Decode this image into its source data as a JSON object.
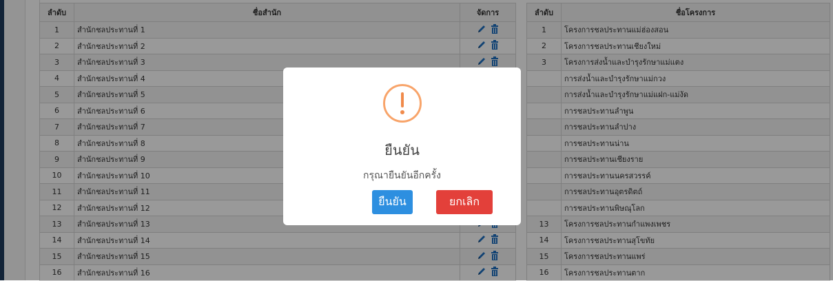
{
  "left_table": {
    "headers": {
      "no": "ลำดับ",
      "name": "ชื่อสำนัก",
      "manage": "จัดการ"
    },
    "rows": [
      {
        "no": "1",
        "name": "สำนักชลประทานที่ 1"
      },
      {
        "no": "2",
        "name": "สำนักชลประทานที่ 2"
      },
      {
        "no": "3",
        "name": "สำนักชลประทานที่ 3"
      },
      {
        "no": "4",
        "name": "สำนักชลประทานที่ 4"
      },
      {
        "no": "5",
        "name": "สำนักชลประทานที่ 5"
      },
      {
        "no": "6",
        "name": "สำนักชลประทานที่ 6"
      },
      {
        "no": "7",
        "name": "สำนักชลประทานที่ 7"
      },
      {
        "no": "8",
        "name": "สำนักชลประทานที่ 8"
      },
      {
        "no": "9",
        "name": "สำนักชลประทานที่ 9"
      },
      {
        "no": "10",
        "name": "สำนักชลประทานที่ 10"
      },
      {
        "no": "11",
        "name": "สำนักชลประทานที่ 11"
      },
      {
        "no": "12",
        "name": "สำนักชลประทานที่ 12"
      },
      {
        "no": "13",
        "name": "สำนักชลประทานที่ 13"
      },
      {
        "no": "14",
        "name": "สำนักชลประทานที่ 14"
      },
      {
        "no": "15",
        "name": "สำนักชลประทานที่ 15"
      },
      {
        "no": "16",
        "name": "สำนักชลประทานที่ 16"
      }
    ]
  },
  "right_table": {
    "headers": {
      "no": "ลำดับ",
      "name": "ชื่อโครงการ"
    },
    "rows": [
      {
        "no": "1",
        "name": "โครงการชลประทานแม่ฮ่องสอน"
      },
      {
        "no": "2",
        "name": "โครงการชลประทานเชียงใหม่"
      },
      {
        "no": "3",
        "name": "โครงการส่งน้ำและบำรุงรักษาแม่แตง"
      },
      {
        "no": "",
        "name": "การส่งน้ำและบำรุงรักษาแม่กวง"
      },
      {
        "no": "",
        "name": "การส่งน้ำและบำรุงรักษาแม่แฝก-แม่งัด"
      },
      {
        "no": "",
        "name": "การชลประทานลำพูน"
      },
      {
        "no": "",
        "name": "การชลประทานลำปาง"
      },
      {
        "no": "",
        "name": "การชลประทานน่าน"
      },
      {
        "no": "",
        "name": "การชลประทานเชียงราย"
      },
      {
        "no": "",
        "name": "การชลประทานนครสวรรค์"
      },
      {
        "no": "",
        "name": "การชลประทานอุตรดิตถ์"
      },
      {
        "no": "",
        "name": "การชลประทานพิษณุโลก"
      },
      {
        "no": "13",
        "name": "โครงการชลประทานกำแพงเพชร"
      },
      {
        "no": "14",
        "name": "โครงการชลประทานสุโขทัย"
      },
      {
        "no": "15",
        "name": "โครงการชลประทานแพร่"
      },
      {
        "no": "16",
        "name": "โครงการชลประทานตาก"
      }
    ]
  },
  "icons": {
    "edit": "pencil-icon",
    "delete": "trash-icon"
  },
  "colors": {
    "edit": "#1d6fc0",
    "delete": "#1d6fc0",
    "warning": "#f08a4a",
    "confirm": "#2d8fe0",
    "cancel": "#e3403a"
  },
  "modal": {
    "icon": "warning-icon",
    "title": "ยืนยัน",
    "text": "กรุณายืนยันอีกครั้ง",
    "confirm_label": "ยืนยัน",
    "cancel_label": "ยกเลิก"
  }
}
